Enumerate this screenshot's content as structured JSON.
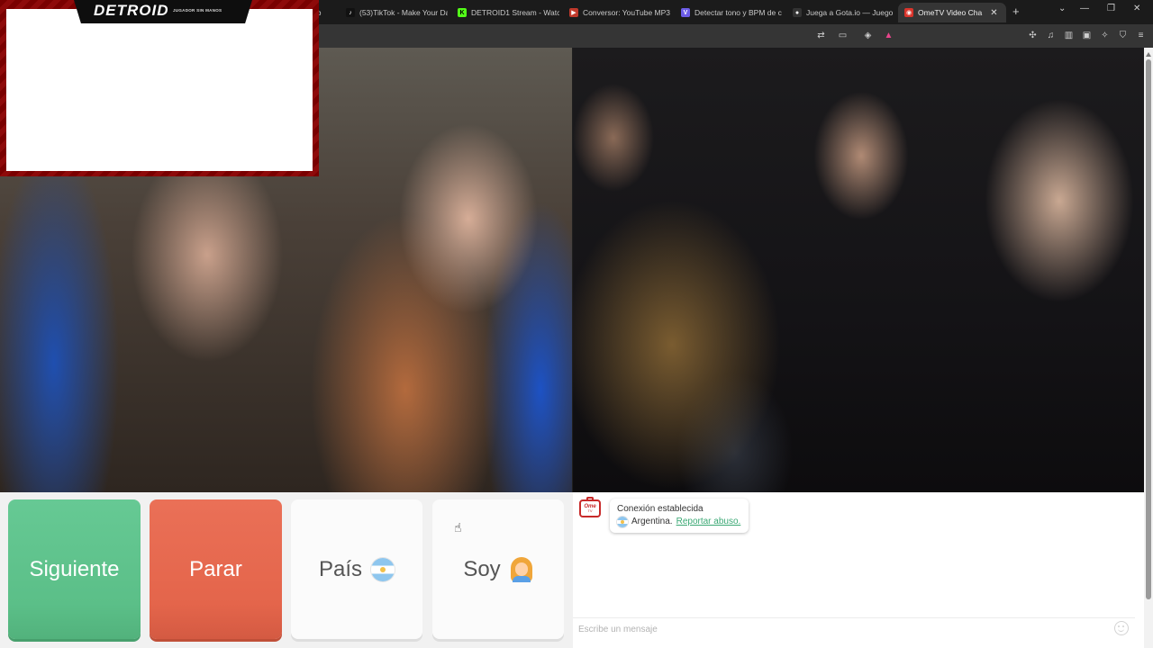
{
  "browser": {
    "tabs": [
      {
        "label": "eb",
        "icon": "generic-icon",
        "color": "#888888"
      },
      {
        "label": "(53)TikTok - Make Your Da",
        "icon": "tiktok-icon",
        "color": "#111111"
      },
      {
        "label": "DETROID1 Stream - Watc",
        "icon": "kick-icon",
        "color": "#53fc18"
      },
      {
        "label": "Conversor: YouTube MP3",
        "icon": "converter-icon",
        "color": "#c0392b"
      },
      {
        "label": "Detectar tono y BPM de c",
        "icon": "vocal-icon",
        "color": "#6c5ce7"
      },
      {
        "label": "Juega a Gota.io — Juego",
        "icon": "gota-icon",
        "color": "#333333"
      },
      {
        "label": "OmeTV Video Cha",
        "icon": "ometv-icon",
        "color": "#d9342b",
        "active": true
      }
    ],
    "new_tab": "+",
    "window_controls": {
      "menu": "⌄",
      "minimize": "—",
      "restore": "❐",
      "close": "✕"
    }
  },
  "overlay": {
    "name": "DETROID",
    "subtitle": "JUGADOR SIN MANOS"
  },
  "controls": {
    "next_label": "Siguiente",
    "stop_label": "Parar",
    "country_label": "País",
    "gender_label": "Soy"
  },
  "chat": {
    "logo_line1": "Ome",
    "logo_line2": "TV",
    "status_message": "Conexión establecida",
    "country_text": "Argentina.",
    "report_link": "Reportar abuso.",
    "input_placeholder": "Escribe un mensaje"
  },
  "colors": {
    "next": "#5bbf88",
    "stop": "#e4654b",
    "link": "#3aa874"
  }
}
